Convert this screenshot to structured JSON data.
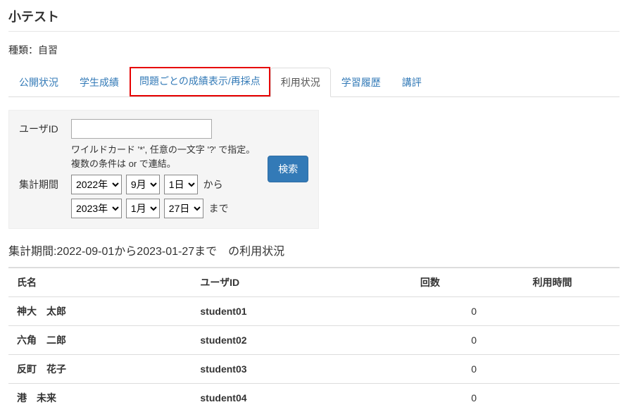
{
  "page": {
    "title": "小テスト",
    "type_label": "種類：",
    "type_value": "自習"
  },
  "tabs": [
    {
      "label": "公開状況"
    },
    {
      "label": "学生成績"
    },
    {
      "label": "問題ごとの成績表示/再採点"
    },
    {
      "label": "利用状況"
    },
    {
      "label": "学習履歴"
    },
    {
      "label": "講評"
    }
  ],
  "filter": {
    "user_id_label": "ユーザID",
    "user_id_value": "",
    "hint_line1": "ワイルドカード '*', 任意の一文字 '?' で指定。",
    "hint_line2": "複数の条件は or で連結。",
    "period_label": "集計期間",
    "from": {
      "year": "2022年",
      "month": "9月",
      "day": "1日",
      "suffix": "から"
    },
    "to": {
      "year": "2023年",
      "month": "1月",
      "day": "27日",
      "suffix": "まで"
    },
    "search_label": "検索"
  },
  "summary": "集計期間:2022-09-01から2023-01-27まで　の利用状況",
  "table": {
    "headers": {
      "name": "氏名",
      "user_id": "ユーザID",
      "count": "回数",
      "time": "利用時間"
    },
    "rows": [
      {
        "name": "神大　太郎",
        "user_id": "student01",
        "count": "0",
        "time": ""
      },
      {
        "name": "六角　二郎",
        "user_id": "student02",
        "count": "0",
        "time": ""
      },
      {
        "name": "反町　花子",
        "user_id": "student03",
        "count": "0",
        "time": ""
      },
      {
        "name": "港　未来",
        "user_id": "student04",
        "count": "0",
        "time": ""
      }
    ]
  }
}
